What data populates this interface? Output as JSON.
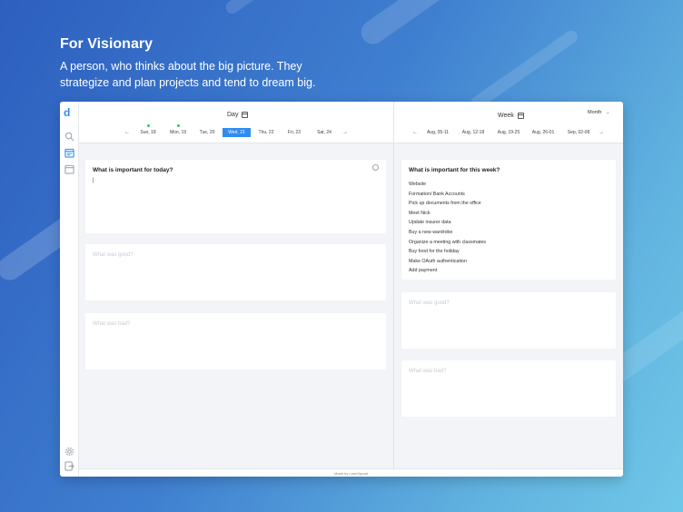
{
  "hero": {
    "title": "For Visionary",
    "subtitle": "A person, who thinks about the big picture. They strategize and plan projects and tend to dream big."
  },
  "sidebar": {
    "logo": "d",
    "icons": [
      "search-icon",
      "calendar-day-icon",
      "calendar-week-icon",
      "settings-icon",
      "logout-icon"
    ]
  },
  "day_panel": {
    "mode": "Day",
    "prev_arrow": "←",
    "next_arrow": "→",
    "days": [
      {
        "label": "Sun, 18",
        "dot": true,
        "active": false
      },
      {
        "label": "Mon, 19",
        "dot": true,
        "active": false
      },
      {
        "label": "Tue, 20",
        "dot": false,
        "active": false
      },
      {
        "label": "Wed, 21",
        "dot": false,
        "active": true
      },
      {
        "label": "Thu, 22",
        "dot": false,
        "active": false
      },
      {
        "label": "Fri, 23",
        "dot": false,
        "active": false
      },
      {
        "label": "Sat, 24",
        "dot": false,
        "active": false
      }
    ],
    "important_title": "What is important for today?",
    "important_value": "|",
    "good_placeholder": "What was good?",
    "bad_placeholder": "What was bad?"
  },
  "week_panel": {
    "mode": "Week",
    "switch_label": "Month",
    "switch_arrow": "→",
    "prev_arrow": "←",
    "next_arrow": "→",
    "weeks": [
      "Aug, 05-11",
      "Aug, 12-18",
      "Aug, 19-25",
      "Aug, 26-01",
      "Sep, 02-08"
    ],
    "important_title": "What is important for this week?",
    "items": [
      "Website",
      "Formation/ Bank Accounts",
      "Pick up documents from the office",
      "Meet Nick",
      "Update insurer data",
      "Buy a new wardrobe",
      "Organize a meeting with classmates",
      "Buy food for the holiday",
      "Make OAuth authentication",
      "Add payment"
    ],
    "good_placeholder": "What was good?",
    "bad_placeholder": "What was bad?"
  },
  "footer": {
    "text": "Made by LeanSquad"
  },
  "colors": {
    "accent": "#2f8cf0",
    "dot": "#36c26a"
  }
}
